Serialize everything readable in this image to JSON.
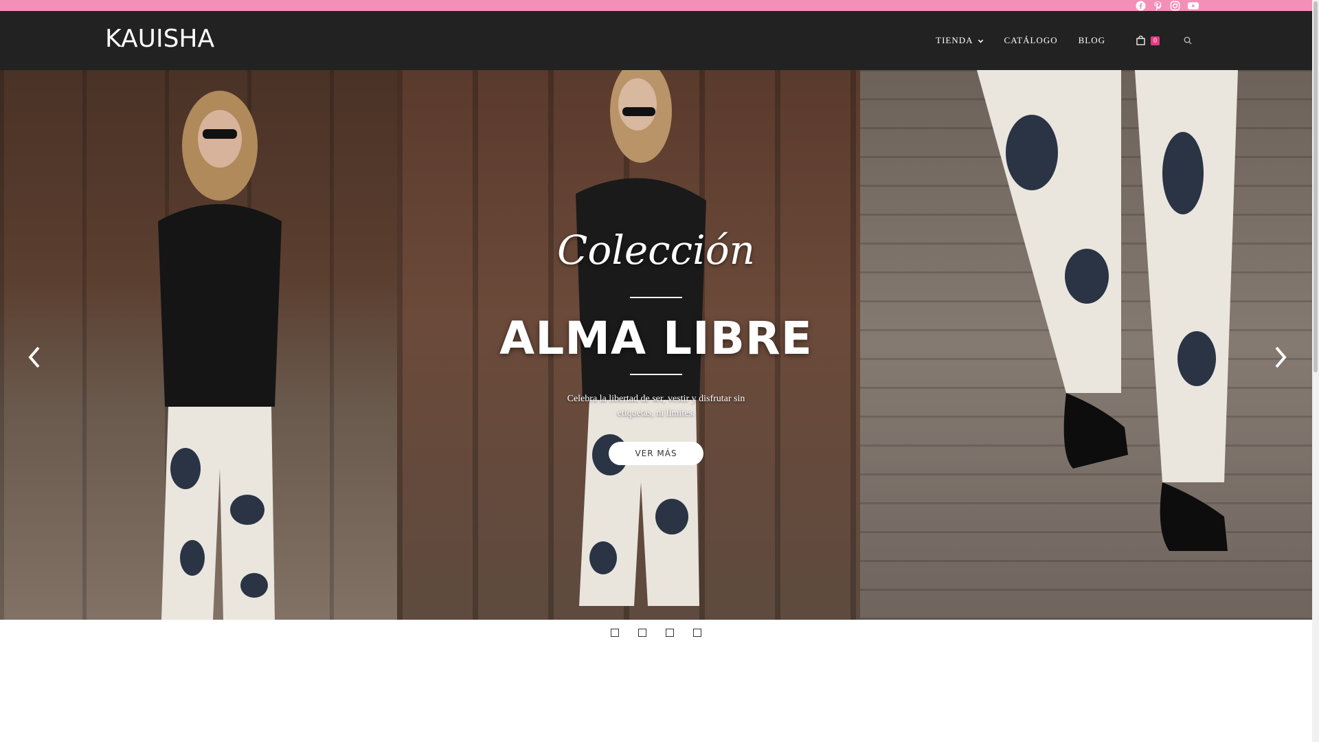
{
  "brand": {
    "logo": "KAUISHA",
    "accent": "#f48fb7",
    "badge_color": "#e63b82",
    "header_bg": "#222222"
  },
  "social": [
    "facebook-icon",
    "pinterest-icon",
    "instagram-icon",
    "youtube-icon"
  ],
  "nav": {
    "tienda": "TIENDA",
    "catalogo": "CATÁLOGO",
    "blog": "BLOG",
    "cart_count": "0"
  },
  "hero": {
    "script_title": "Colección",
    "title": "ALMA LIBRE",
    "description": "Celebra la libertad de ser, vestir y disfrutar sin etiquetas, ni límites.",
    "button": "VER MÁS"
  },
  "slider": {
    "slide_count": 4,
    "active_slide": 1
  }
}
